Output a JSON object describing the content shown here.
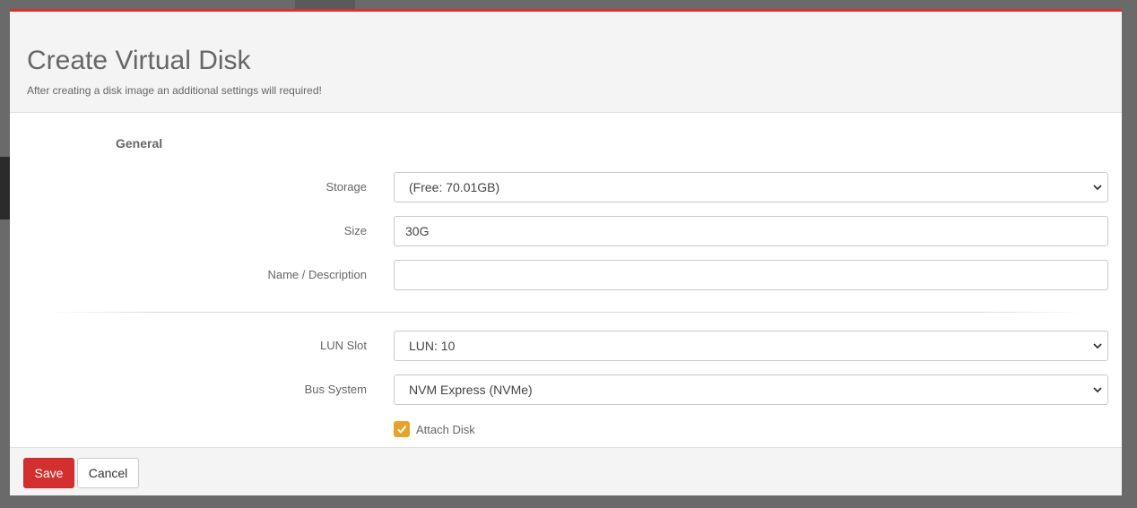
{
  "modal": {
    "title": "Create Virtual Disk",
    "subtitle": "After creating a disk image an additional settings will required!",
    "accent_color": "#d9312b"
  },
  "form": {
    "section_title": "General",
    "storage": {
      "label": "Storage",
      "value": "(Free: 70.01GB)"
    },
    "size": {
      "label": "Size",
      "value": "30G"
    },
    "name": {
      "label": "Name / Description",
      "value": "",
      "placeholder": ""
    },
    "lun_slot": {
      "label": "LUN Slot",
      "value": "LUN: 10"
    },
    "bus_system": {
      "label": "Bus System",
      "value": "NVM Express (NVMe)"
    },
    "attach_disk": {
      "label": "Attach Disk",
      "checked": true,
      "color": "#e8a22b"
    }
  },
  "footer": {
    "save_label": "Save",
    "cancel_label": "Cancel",
    "save_color": "#d32f2f"
  }
}
